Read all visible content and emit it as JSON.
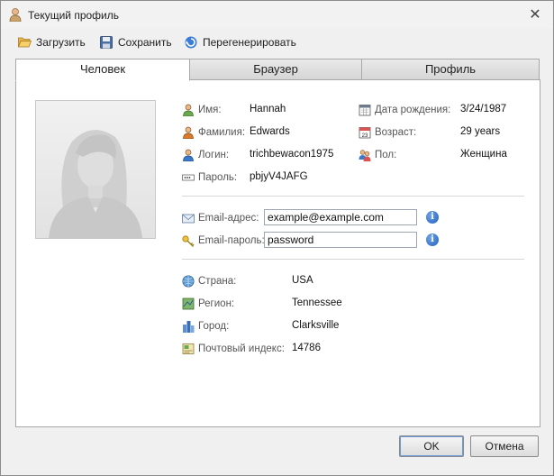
{
  "window": {
    "title": "Текущий профиль",
    "close_glyph": "✕"
  },
  "toolbar": {
    "load_label": "Загрузить",
    "save_label": "Сохранить",
    "regen_label": "Перегенерировать"
  },
  "tabs": [
    {
      "label": "Человек",
      "active": true
    },
    {
      "label": "Браузер",
      "active": false
    },
    {
      "label": "Профиль",
      "active": false
    }
  ],
  "person": {
    "name_label": "Имя:",
    "name": "Hannah",
    "surname_label": "Фамилия:",
    "surname": "Edwards",
    "login_label": "Логин:",
    "login": "trichbewacon1975",
    "password_label": "Пароль:",
    "password": "pbjyV4JAFG",
    "birth_label": "Дата рождения:",
    "birth": "3/24/1987",
    "age_label": "Возраст:",
    "age": "29 years",
    "gender_label": "Пол:",
    "gender": "Женщина"
  },
  "email": {
    "address_label": "Email-адрес:",
    "address": "example@example.com",
    "password_label": "Email-пароль:",
    "password": "password",
    "info_glyph": "i"
  },
  "location": {
    "country_label": "Страна:",
    "country": "USA",
    "region_label": "Регион:",
    "region": "Tennessee",
    "city_label": "Город:",
    "city": "Clarksville",
    "zip_label": "Почтовый индекс:",
    "zip": "14786"
  },
  "footer": {
    "ok_label": "OK",
    "cancel_label": "Отмена"
  }
}
